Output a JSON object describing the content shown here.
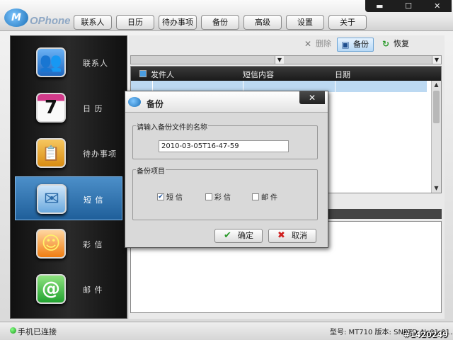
{
  "app": {
    "logo_letter": "M",
    "logo_text": "OPhone",
    "window_controls": [
      "▬",
      "☐",
      "✕"
    ]
  },
  "nav": [
    "联系人",
    "日历",
    "待办事项",
    "备份",
    "高级",
    "设置",
    "关于"
  ],
  "sidebar": {
    "items": [
      {
        "label": "联系人",
        "icon": "contacts-icon",
        "glyph": "👥",
        "color": "#2f7fd8"
      },
      {
        "label": "日 历",
        "icon": "calendar-icon",
        "glyph": "7",
        "color": "#f5f5f5"
      },
      {
        "label": "待办事项",
        "icon": "todo-icon",
        "glyph": "📋",
        "color": "#e6a624"
      },
      {
        "label": "短 信",
        "icon": "sms-envelope-icon",
        "glyph": "✉",
        "color": "#6db0e6"
      },
      {
        "label": "彩 信",
        "icon": "mms-icon",
        "glyph": "☺",
        "color": "#f08b1e"
      },
      {
        "label": "邮 件",
        "icon": "email-at-icon",
        "glyph": "@",
        "color": "#3cb843"
      }
    ],
    "active_index": 3
  },
  "toolbar": {
    "delete_label": "删除",
    "backup_label": "备份",
    "restore_label": "恢复"
  },
  "list": {
    "columns": [
      "发件人",
      "短信内容",
      "日期"
    ]
  },
  "dialog": {
    "title": "备份",
    "close_glyph": "✕",
    "name_legend": "请输入备份文件的名称",
    "filename": "2010-03-05T16-47-59",
    "items_legend": "备份项目",
    "options": [
      {
        "label": "短信",
        "checked": true
      },
      {
        "label": "彩信",
        "checked": false
      },
      {
        "label": "邮件",
        "checked": false
      }
    ],
    "ok_label": "确定",
    "cancel_label": "取消"
  },
  "status": {
    "connection": "手机已连接",
    "model_info": "型号: MT710 版本: SNPTD_N_01.01.5T"
  },
  "watermark": "#1420249",
  "colors": {
    "active_item": "#2f73b3",
    "row_highlight": "#bcd9f2",
    "status_ok": "#1a9a1a"
  }
}
